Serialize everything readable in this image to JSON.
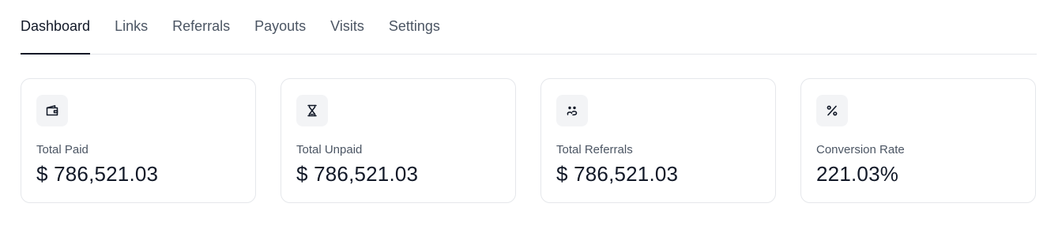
{
  "tabs": [
    {
      "label": "Dashboard",
      "active": true
    },
    {
      "label": "Links",
      "active": false
    },
    {
      "label": "Referrals",
      "active": false
    },
    {
      "label": "Payouts",
      "active": false
    },
    {
      "label": "Visits",
      "active": false
    },
    {
      "label": "Settings",
      "active": false
    }
  ],
  "cards": [
    {
      "icon": "wallet-icon",
      "label": "Total Paid",
      "value": "$ 786,521.03"
    },
    {
      "icon": "hourglass-icon",
      "label": "Total Unpaid",
      "value": "$ 786,521.03"
    },
    {
      "icon": "users-icon",
      "label": "Total Referrals",
      "value": "$ 786,521.03"
    },
    {
      "icon": "percent-icon",
      "label": "Conversion Rate",
      "value": "221.03%"
    }
  ],
  "colors": {
    "text_primary": "#111827",
    "text_secondary": "#4b5563",
    "border": "#e5e7eb",
    "icon_bg": "#f3f4f6"
  }
}
